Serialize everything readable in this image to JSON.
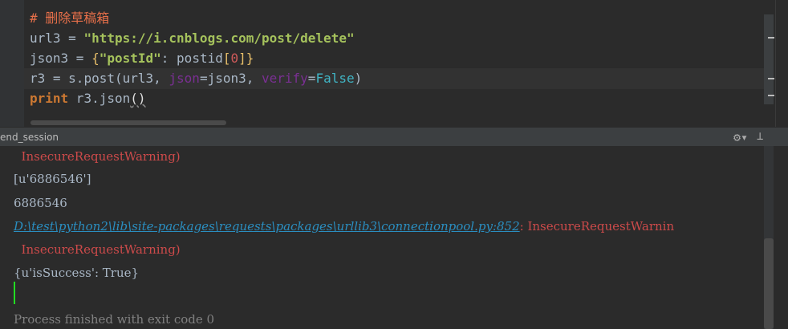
{
  "editor": {
    "lines": [
      {
        "comment": "# 删除草稿箱"
      },
      {
        "var": "url3",
        "op": " = ",
        "value": "\"https://i.cnblogs.com/post/delete\""
      },
      {
        "var": "json3",
        "op": " = ",
        "open": "{",
        "key": "\"postId\"",
        "colon": ": ",
        "expr_a": "postid",
        "bracket_open": "[",
        "index": "0",
        "bracket_close": "]",
        "close": "}"
      },
      {
        "var": "r3",
        "op": " = ",
        "call": "s.post(url3, ",
        "p1": "json",
        "eq1": "=json3, ",
        "p2": "verify",
        "eq2": "=",
        "bool": "False",
        "end": ")"
      },
      {
        "kw": "print",
        "rest": " r3.json",
        "paren": "()"
      }
    ]
  },
  "run_panel": {
    "tab_label": "end_session",
    "settings_icon": "gear-icon",
    "pin_icon": "pin-icon"
  },
  "console": {
    "lines": [
      {
        "text": "  InsecureRequestWarning)",
        "style": "warn"
      },
      {
        "text": "[u'6886546']",
        "style": "normal"
      },
      {
        "text": "6886546",
        "style": "normal"
      },
      {
        "link": "D:\\test\\python2\\lib\\site-packages\\requests\\packages\\urllib3\\connectionpool.py:852",
        "after": ": InsecureRequestWarnin"
      },
      {
        "text": "  InsecureRequestWarning)",
        "style": "warn"
      },
      {
        "text": "{u'isSuccess': True}",
        "style": "normal"
      },
      {
        "text": "Process finished with exit code 0",
        "style": "gray"
      }
    ]
  }
}
